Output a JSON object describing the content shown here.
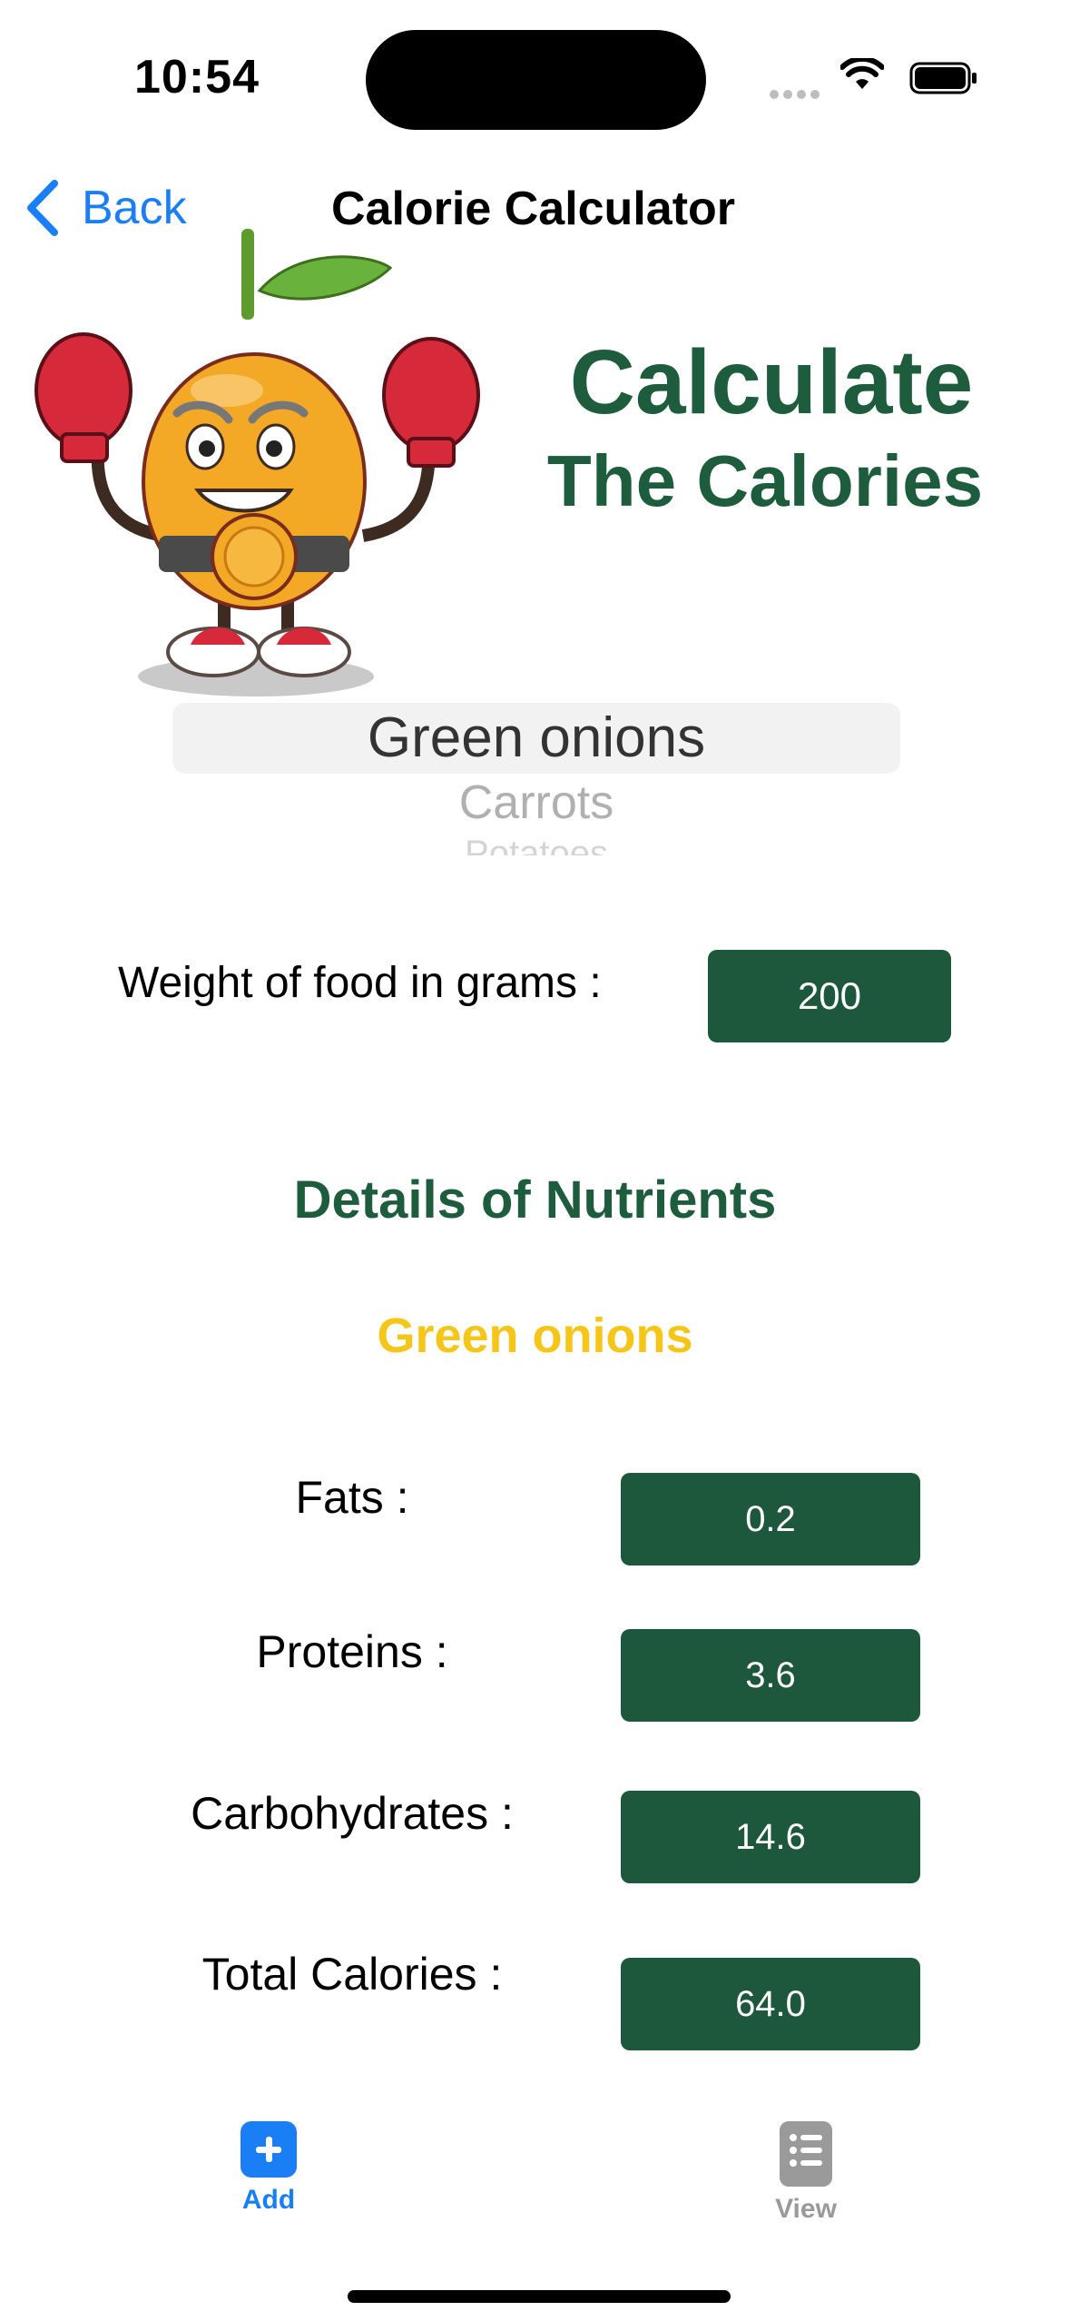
{
  "status_bar": {
    "time": "10:54"
  },
  "nav": {
    "back_label": "Back",
    "title": "Calorie Calculator"
  },
  "hero": {
    "line1": "Calculate",
    "line2": "The Calories"
  },
  "picker": {
    "selected": "Green onions",
    "next": "Carrots",
    "next_partial": "Potatoes"
  },
  "weight": {
    "label": "Weight of food in grams :",
    "value": "200"
  },
  "details": {
    "title": "Details of Nutrients",
    "food": "Green onions",
    "rows": [
      {
        "label": "Fats :",
        "value": "0.2"
      },
      {
        "label": "Proteins :",
        "value": "3.6"
      },
      {
        "label": "Carbohydrates :",
        "value": "14.6"
      },
      {
        "label": "Total Calories :",
        "value": "64.0"
      }
    ]
  },
  "tabbar": {
    "add_label": "Add",
    "view_label": "View",
    "add_icon": "plus-square-icon",
    "view_icon": "list-doc-icon"
  },
  "colors": {
    "accent": "#1a7ff5",
    "brand_green": "#1d573c",
    "food_yellow": "#f5c518"
  }
}
